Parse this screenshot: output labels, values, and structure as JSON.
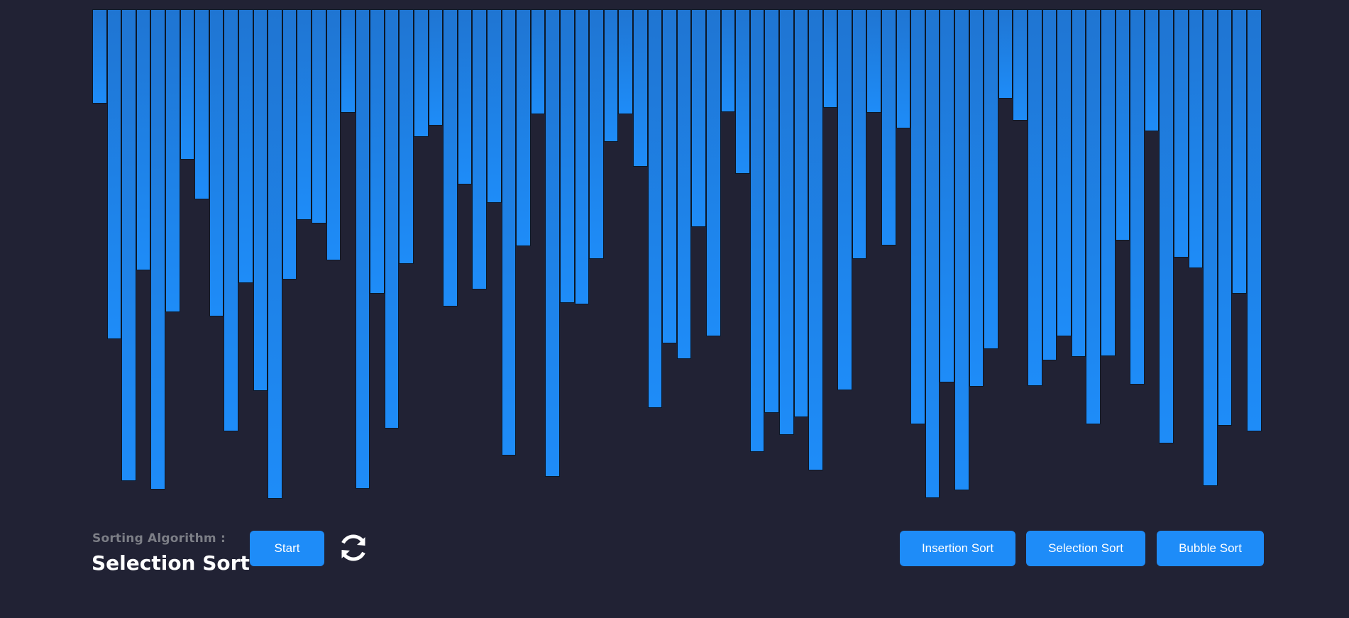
{
  "controls": {
    "algorithm_label": "Sorting Algorithm :",
    "algorithm_name": "Selection Sort",
    "start_label": "Start",
    "refresh_icon": "refresh-icon"
  },
  "sort_buttons": {
    "insertion": "Insertion Sort",
    "selection": "Selection Sort",
    "bubble": "Bubble Sort"
  },
  "colors": {
    "background": "#212234",
    "bar_top": "#1f75d2",
    "bar_bottom": "#1e8cf8",
    "button": "#1e8cf8"
  },
  "array": {
    "count": 80,
    "max_value": 680,
    "values": [
      133,
      465,
      665,
      368,
      677,
      427,
      212,
      268,
      433,
      595,
      386,
      538,
      690,
      381,
      297,
      302,
      354,
      146,
      676,
      401,
      591,
      359,
      180,
      164,
      419,
      247,
      395,
      273,
      629,
      334,
      148,
      659,
      414,
      416,
      352,
      187,
      148,
      222,
      562,
      471,
      493,
      307,
      461,
      145,
      232,
      624,
      569,
      600,
      575,
      650,
      139,
      537,
      352,
      146,
      333,
      168,
      585,
      689,
      526,
      678,
      532,
      479,
      126,
      157,
      531,
      495,
      461,
      490,
      585,
      489,
      326,
      529,
      172,
      612,
      350,
      365,
      672,
      587,
      401,
      595
    ]
  }
}
